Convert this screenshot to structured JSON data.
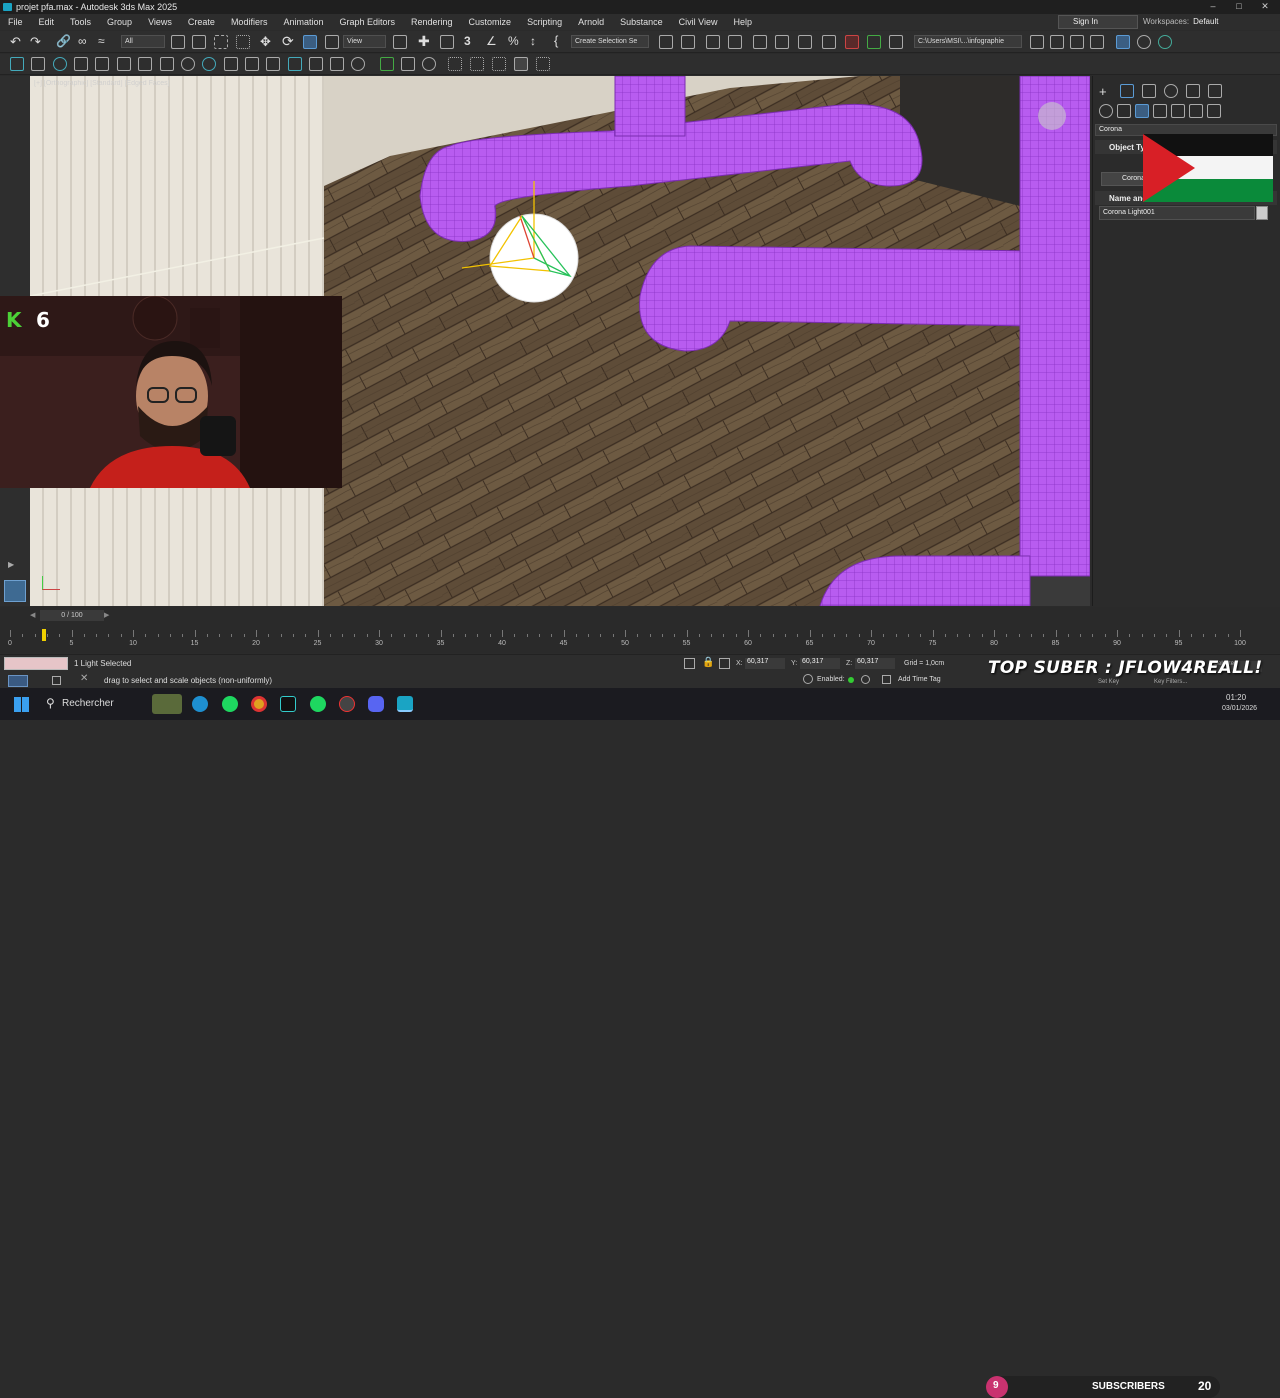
{
  "window": {
    "title": "projet pfa.max - Autodesk 3ds Max 2025"
  },
  "menu": [
    "File",
    "Edit",
    "Tools",
    "Group",
    "Views",
    "Create",
    "Modifiers",
    "Animation",
    "Graph Editors",
    "Rendering",
    "Customize",
    "Scripting",
    "Arnold",
    "Substance",
    "Civil View",
    "Help"
  ],
  "account": {
    "sign_in": "Sign In",
    "workspaces_label": "Workspaces:",
    "workspace": "Default"
  },
  "toolbar": {
    "filter": "All",
    "view": "View",
    "selection_set": "Create Selection Se",
    "path": "C:\\Users\\MSI\\...\\infographie"
  },
  "viewport": {
    "label": "[+] [Orthographic] [Standard] [Edged Faces]"
  },
  "overlay": {
    "k_count": "6",
    "top_suber": "TOP SUBER : JFLOW4REALL!",
    "subscribers_label": "SUBSCRIBERS",
    "subscribers_count": "20",
    "sub_badge": "9"
  },
  "command_panel": {
    "renderer": "Corona",
    "object_type": "Object Type",
    "corona_btn": "Corona",
    "name_color": "Name and Color",
    "object_name": "Corona Light001"
  },
  "timeline": {
    "frame": "0 / 100",
    "ticks": [
      "0",
      "5",
      "10",
      "15",
      "20",
      "25",
      "30",
      "35",
      "40",
      "45",
      "50",
      "55",
      "60",
      "65",
      "70",
      "75",
      "80",
      "85",
      "90",
      "95",
      "100"
    ]
  },
  "status": {
    "selection": "1 Light Selected",
    "prompt": "drag to select and scale objects (non-uniformly)",
    "x_label": "X:",
    "x": "60,317",
    "y_label": "Y:",
    "y": "60,317",
    "z_label": "Z:",
    "z": "60,317",
    "grid": "Grid = 1,0cm",
    "enabled": "Enabled:",
    "add_time_tag": "Add Time Tag",
    "set_key": "Set Key",
    "key_filters": "Key Filters...",
    "selected": "Selected"
  },
  "taskbar": {
    "search": "Rechercher",
    "time": "01:20",
    "date": "03/01/2026"
  }
}
